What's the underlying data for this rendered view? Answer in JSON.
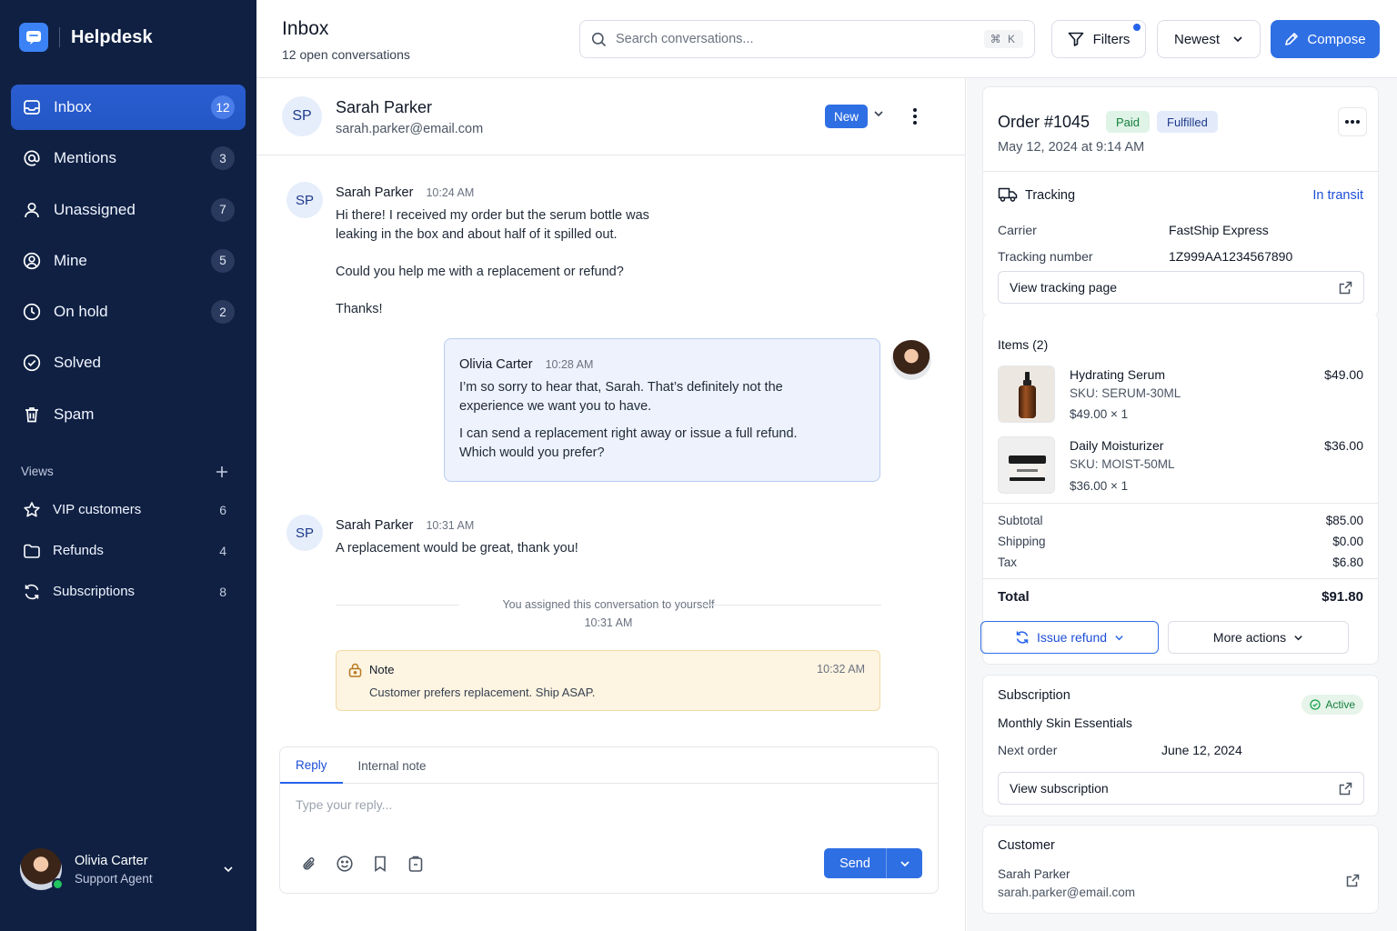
{
  "app": {
    "name": "Helpdesk"
  },
  "sidebar": {
    "items": [
      {
        "label": "Inbox",
        "count": "12",
        "icon": "inbox-icon"
      },
      {
        "label": "Mentions",
        "count": "3",
        "icon": "at-icon"
      },
      {
        "label": "Unassigned",
        "count": "7",
        "icon": "user-icon"
      },
      {
        "label": "Mine",
        "count": "5",
        "icon": "user-circle-icon"
      },
      {
        "label": "On hold",
        "count": "2",
        "icon": "clock-icon"
      },
      {
        "label": "Solved",
        "count": "",
        "icon": "check-circle-icon"
      },
      {
        "label": "Spam",
        "count": "",
        "icon": "trash-icon"
      }
    ],
    "views_title": "Views",
    "views": [
      {
        "label": "VIP customers",
        "count": "6",
        "icon": "star-icon"
      },
      {
        "label": "Refunds",
        "count": "4",
        "icon": "folder-icon"
      },
      {
        "label": "Subscriptions",
        "count": "8",
        "icon": "refresh-icon"
      }
    ],
    "user": {
      "name": "Olivia Carter",
      "role": "Support Agent"
    }
  },
  "header": {
    "title": "Inbox",
    "subtitle": "12 open conversations",
    "search_placeholder": "Search conversations...",
    "shortcut": "⌘ K",
    "filters_label": "Filters",
    "sort_label": "Newest",
    "compose_label": "Compose"
  },
  "conversation": {
    "contact": {
      "initials": "SP",
      "name": "Sarah Parker",
      "email": "sarah.parker@email.com",
      "status": "New"
    },
    "messages": [
      {
        "author": "Sarah Parker",
        "initials": "SP",
        "time": "10:24 AM",
        "lines": [
          "Hi there! I received my order but the serum bottle was",
          "leaking in the box and about half of it spilled out.",
          "Could you help me with a replacement or refund?",
          "Thanks!"
        ]
      },
      {
        "author": "Olivia Carter",
        "time": "10:28 AM",
        "lines": [
          "I’m so sorry to hear that, Sarah. That’s definitely not the",
          "experience we want you to have.",
          "I can send a replacement right away or issue a full refund.",
          "Which would you prefer?"
        ]
      },
      {
        "author": "Sarah Parker",
        "initials": "SP",
        "time": "10:31 AM",
        "lines": [
          "A replacement would be great, thank you!"
        ]
      }
    ],
    "system_event": {
      "text": "You assigned this conversation to yourself",
      "time": "10:31 AM"
    },
    "note": {
      "label": "Note",
      "time": "10:32 AM",
      "text": "Customer prefers replacement. Ship ASAP."
    },
    "composer": {
      "tabs": [
        "Reply",
        "Internal note"
      ],
      "placeholder": "Type your reply...",
      "send_label": "Send"
    }
  },
  "order": {
    "title": "Order #1045",
    "badges": [
      "Paid",
      "Fulfilled"
    ],
    "date": "May 12, 2024 at 9:14 AM",
    "tracking": {
      "label": "Tracking",
      "status": "In transit",
      "carrier_label": "Carrier",
      "carrier": "FastShip Express",
      "number_label": "Tracking number",
      "number": "1Z999AA1234567890",
      "link_label": "View tracking page"
    },
    "items_label": "Items",
    "items_count": "(2)",
    "items": [
      {
        "name": "Hydrating Serum",
        "sku": "SKU: SERUM-30ML",
        "qty": "$49.00 × 1",
        "price": "$49.00"
      },
      {
        "name": "Daily Moisturizer",
        "sku": "SKU: MOIST-50ML",
        "qty": "$36.00 × 1",
        "price": "$36.00"
      }
    ],
    "summary": [
      {
        "label": "Subtotal",
        "value": "$85.00"
      },
      {
        "label": "Shipping",
        "value": "$0.00"
      },
      {
        "label": "Tax",
        "value": "$6.80"
      }
    ],
    "total_label": "Total",
    "total": "$91.80",
    "refund_label": "Issue refund",
    "more_actions_label": "More actions"
  },
  "subscription": {
    "title": "Subscription",
    "status": "Active",
    "plan": "Monthly Skin Essentials",
    "next_label": "Next order",
    "next_date": "June 12, 2024",
    "link_label": "View subscription"
  },
  "customer": {
    "title": "Customer",
    "name": "Sarah Parker",
    "email": "sarah.parker@email.com"
  },
  "colors": {
    "sidebar_bg": "#0f2043",
    "accent": "#2f6fe4",
    "note_bg": "#fdf4e1",
    "agent_bubble": "#edf2fc"
  }
}
